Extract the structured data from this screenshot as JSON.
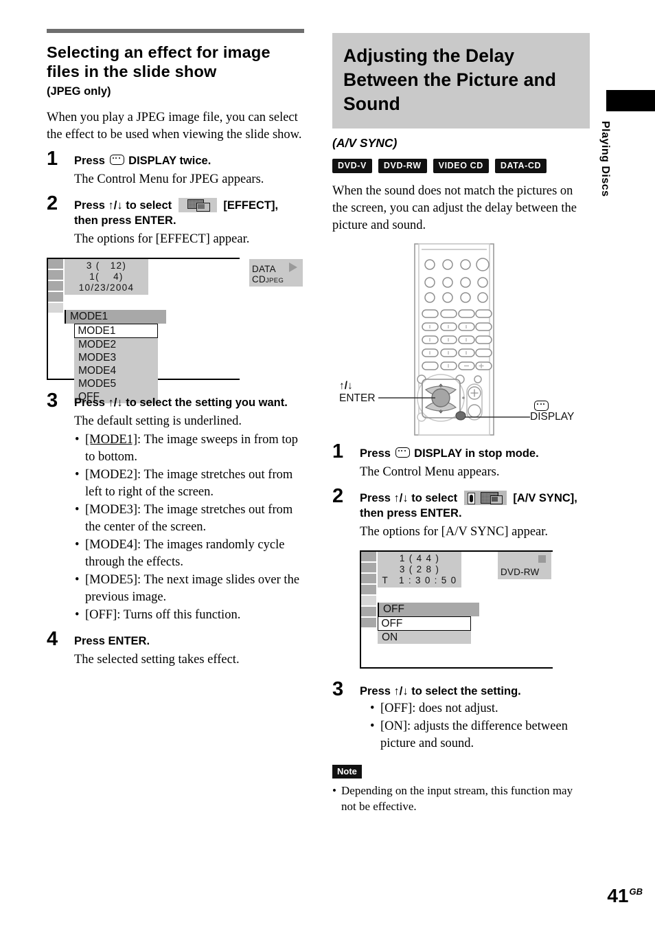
{
  "page": {
    "number": "41",
    "region_suffix": "GB",
    "side_tab_label": "Playing Discs"
  },
  "left_column": {
    "title": "Selecting an effect for image files in the slide show",
    "subtitle": "(JPEG only)",
    "intro": "When you play a JPEG image file, you can select the effect to be used when viewing the slide show.",
    "steps": [
      {
        "num": "1",
        "head_before_icon": "Press",
        "icon": "display-icon",
        "head_after_icon": "DISPLAY twice.",
        "sub": "The Control Menu for JPEG appears."
      },
      {
        "num": "2",
        "head_before_icon": "Press ↑/↓ to select",
        "icon": "effect-menu-icon",
        "head_after_icon": "[EFFECT], then press ENTER.",
        "sub": "The options for [EFFECT] appear."
      },
      {
        "num": "3",
        "head": "Press ↑/↓ to select the setting you want.",
        "sub": "The default setting is underlined.",
        "bullets": [
          {
            "label": "[MODE1]",
            "underlined": true,
            "text": ": The image sweeps in from top to bottom."
          },
          {
            "label": "[MODE2]",
            "underlined": false,
            "text": ": The image stretches out from left to right of the screen."
          },
          {
            "label": "[MODE3]",
            "underlined": false,
            "text": ": The image stretches out from the center of the screen."
          },
          {
            "label": "[MODE4]",
            "underlined": false,
            "text": ": The images randomly cycle through the effects."
          },
          {
            "label": "[MODE5]",
            "underlined": false,
            "text": ": The next image slides over the previous image."
          },
          {
            "label": "[OFF]",
            "underlined": false,
            "text": ": Turns off this function."
          }
        ]
      },
      {
        "num": "4",
        "head": "Press ENTER.",
        "sub": "The selected setting takes effect."
      }
    ],
    "osd": {
      "info_lines": [
        "3 (   12)",
        "1(    4)",
        "10/23/2004"
      ],
      "disc_label": "DATA CD",
      "disc_label_small": "JPEG",
      "disc_state_icon": "play-triangle-icon",
      "current_value": "MODE1",
      "options": [
        "MODE1",
        "MODE2",
        "MODE3",
        "MODE4",
        "MODE5",
        "OFF"
      ],
      "selected_index": 0
    }
  },
  "right_column": {
    "title": "Adjusting the Delay Between the Picture and Sound",
    "subtitle": "(A/V SYNC)",
    "disc_badges": [
      "DVD-V",
      "DVD-RW",
      "VIDEO CD",
      "DATA-CD"
    ],
    "intro": "When the sound does not match the pictures on the screen, you can adjust the delay between the picture and sound.",
    "remote": {
      "label_updown": "↑/↓",
      "label_enter": "ENTER",
      "label_display": "DISPLAY",
      "display_icon": "display-icon"
    },
    "steps": [
      {
        "num": "1",
        "head_before_icon": "Press",
        "icon": "display-icon",
        "head_after_icon": "DISPLAY in stop mode.",
        "sub": "The Control Menu appears."
      },
      {
        "num": "2",
        "head_before_icon": "Press ↑/↓ to select",
        "icon": "avsync-menu-icon",
        "head_after_icon": "[A/V SYNC], then press ENTER.",
        "sub": "The options for [A/V SYNC] appear."
      },
      {
        "num": "3",
        "head": "Press ↑/↓ to select the setting.",
        "bullets": [
          {
            "label": "[OFF]",
            "underlined": false,
            "text": ": does not adjust."
          },
          {
            "label": "[ON]",
            "underlined": false,
            "text": ": adjusts the difference between picture and sound."
          }
        ]
      }
    ],
    "osd": {
      "info_lines": [
        "1 ( 4 4 )",
        "3 ( 2 8 )",
        "T   1 : 3 0 : 5 0"
      ],
      "disc_label": "DVD-RW",
      "disc_label_small": "",
      "disc_state_icon": "stop-square-icon",
      "current_value": "OFF",
      "options": [
        "OFF",
        "ON"
      ],
      "selected_index": 0
    },
    "note": {
      "tag": "Note",
      "text": "Depending on the input stream, this function may not be effective."
    }
  }
}
